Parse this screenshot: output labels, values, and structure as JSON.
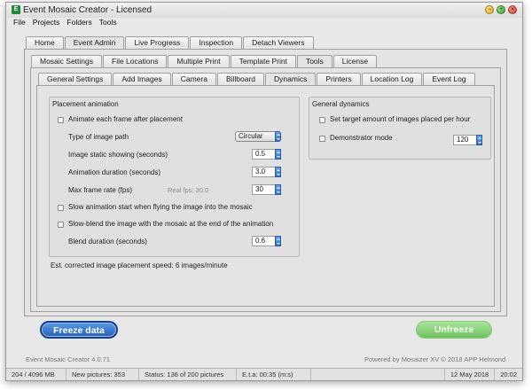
{
  "window": {
    "title": "Event Mosaic Creator - Licensed",
    "icon": "app-logo-icon",
    "controls": {
      "minimize": "–",
      "maximize": "+",
      "close": "×"
    }
  },
  "menu": [
    "File",
    "Projects",
    "Folders",
    "Tools"
  ],
  "main_tabs": [
    "Home",
    "Event Admin",
    "Live Progress",
    "Inspection",
    "Detach Viewers"
  ],
  "admin_tabs": [
    "Mosaic Settings",
    "File Locations",
    "Multiple Print",
    "Template Print",
    "Tools",
    "License"
  ],
  "settings_tabs": [
    "General Settings",
    "Add Images",
    "Camera",
    "Billboard",
    "Dynamics",
    "Printers",
    "Location Log",
    "Event Log"
  ],
  "placement": {
    "title": "Placement animation",
    "animate_each": "Animate each frame after placement",
    "image_path_label": "Type of image path",
    "image_path_value": "Circular",
    "static_label": "Image static showing (seconds)",
    "static_value": "0.5",
    "duration_label": "Animation duration (seconds)",
    "duration_value": "3.0",
    "maxfps_label": "Max frame rate (fps)",
    "real_fps": "Real fps: 30.0",
    "maxfps_value": "30",
    "slow_start": "Slow animation start when flying the image into the mosaic",
    "slow_blend": "Slow-blend the image with the mosaic at the end of the animation",
    "blend_label": "Blend duration (seconds)",
    "blend_value": "0.6"
  },
  "est_speed": "Est. corrected image placement speed: 6 images/minute",
  "general_dynamics": {
    "title": "General dynamics",
    "set_target": "Set target amount of images placed per hour",
    "demo_mode": "Demonstrator mode",
    "demo_value": "120"
  },
  "buttons": {
    "freeze": "Freeze data",
    "unfreeze": "Unfreeze"
  },
  "footer": {
    "version": "Event Mosaic Creator 4.0.71",
    "powered": "Powered by Mosaizer XV © 2018  APP Helmond"
  },
  "status": {
    "memory": "204 / 4096 MB",
    "new_pictures": "New pictures: 353",
    "status": "Status: 136 of 200 pictures",
    "eta": "E.t.a: 00:35 (m:s)",
    "date": "12 May 2018",
    "time": "20:02"
  },
  "colors": {
    "freeze_button": "#2360b8",
    "unfreeze_button": "#6fc25e",
    "app_icon": "#1f8a3a"
  }
}
